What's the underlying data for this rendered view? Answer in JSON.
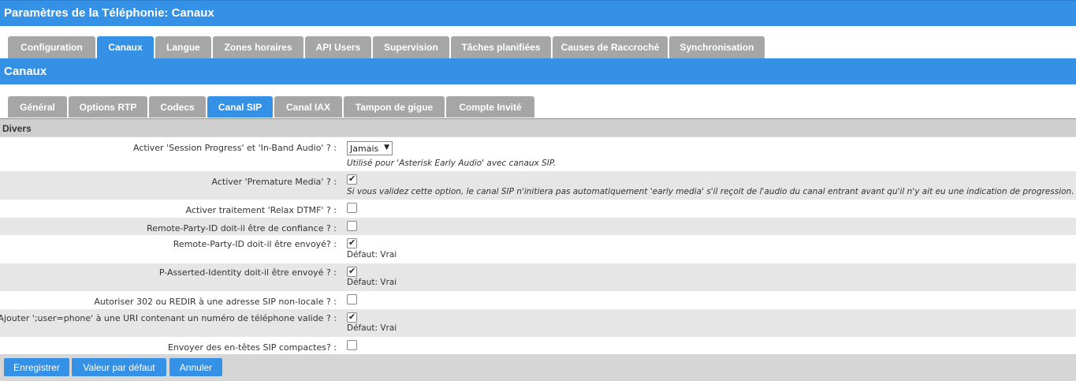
{
  "header": {
    "title": "Paramètres de la Téléphonie:  Canaux"
  },
  "main_tabs": [
    {
      "label": "Configuration"
    },
    {
      "label": "Canaux"
    },
    {
      "label": "Langue"
    },
    {
      "label": "Zones horaires"
    },
    {
      "label": "API Users"
    },
    {
      "label": "Supervision"
    },
    {
      "label": "Tâches planifiées"
    },
    {
      "label": "Causes de Raccroché"
    },
    {
      "label": "Synchronisation"
    }
  ],
  "active_main_tab": "Canaux",
  "section": {
    "title": "Canaux"
  },
  "sub_tabs": [
    {
      "label": "Général"
    },
    {
      "label": "Options RTP"
    },
    {
      "label": "Codecs"
    },
    {
      "label": "Canal SIP"
    },
    {
      "label": "Canal IAX"
    },
    {
      "label": "Tampon de gigue"
    },
    {
      "label": "Compte Invité"
    }
  ],
  "active_sub_tab": "Canal SIP",
  "group": {
    "title": "Divers"
  },
  "rows": [
    {
      "label": "Activer 'Session Progress' et 'In-Band Audio' ? :",
      "type": "select",
      "value": "Jamais",
      "hint": "Utilisé pour 'Asterisk Early Audio' avec canaux SIP."
    },
    {
      "label": "Activer 'Premature Media' ? :",
      "type": "checkbox",
      "checked": true,
      "hint": "Si vous validez cette option, le canal SIP n'initiera pas automatiquement 'early media' s'il reçoit de l'audio du canal entrant avant qu'il n'y ait eu une indication de progression."
    },
    {
      "label": "Activer traitement 'Relax DTMF' ? :",
      "type": "checkbox",
      "checked": false
    },
    {
      "label": "Remote-Party-ID doit-il être de confiance ? :",
      "type": "checkbox",
      "checked": false
    },
    {
      "label": "Remote-Party-ID doit-il être envoyé? :",
      "type": "checkbox",
      "checked": true,
      "hint": "Défaut: Vrai"
    },
    {
      "label": "P-Asserted-Identity doit-il être envoyé ? :",
      "type": "checkbox",
      "checked": true,
      "hint": "Défaut: Vrai"
    },
    {
      "label": "Autoriser 302 ou REDIR à une adresse SIP non-locale ? :",
      "type": "checkbox",
      "checked": false
    },
    {
      "label": "Ajouter ';user=phone' à une URI contenant un numéro de téléphone valide ? :",
      "type": "checkbox",
      "checked": true,
      "hint": "Défaut: Vrai"
    },
    {
      "label": "Envoyer des en-têtes SIP compactes? :",
      "type": "checkbox",
      "checked": false
    }
  ],
  "buttons": {
    "save": "Enregistrer",
    "default": "Valeur par défaut",
    "cancel": "Annuler"
  },
  "colors": {
    "accent": "#3591e6",
    "tab_inactive": "#a6a6a6",
    "row_alt": "#e6e6e6"
  }
}
